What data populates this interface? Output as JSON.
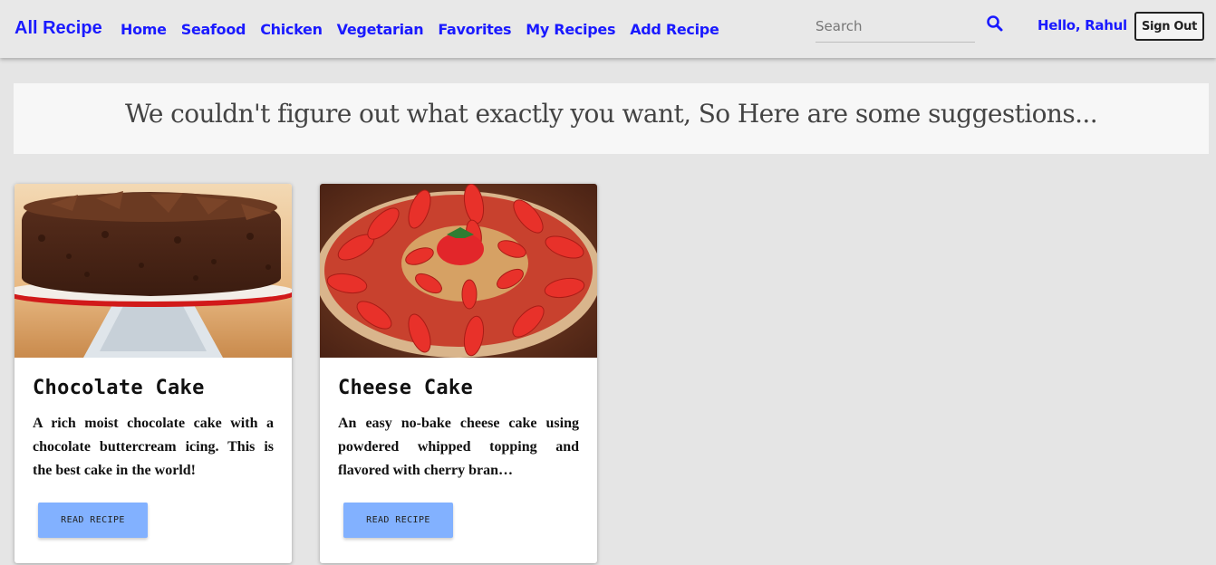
{
  "navbar": {
    "brand": "All Recipe",
    "links": [
      "Home",
      "Seafood",
      "Chicken",
      "Vegetarian",
      "Favorites",
      "My Recipes",
      "Add Recipe"
    ],
    "search_placeholder": "Search",
    "search_icon": "search-icon",
    "greeting": "Hello, Rahul",
    "signout_label": "Sign Out"
  },
  "banner": {
    "message": "We couldn't figure out what exactly you want, So Here are some suggestions..."
  },
  "cards": [
    {
      "title": "Chocolate Cake",
      "description": "A rich moist chocolate cake with a chocolate buttercream icing. This is the best cake in the world!",
      "button_label": "READ RECIPE"
    },
    {
      "title": "Cheese Cake",
      "description": "An easy no-bake cheese cake using powdered whipped topping and flavored with cherry bran…",
      "button_label": "READ RECIPE"
    }
  ],
  "colors": {
    "link": "#1a1aff",
    "button": "#82b1ff",
    "background": "#e5e5e5"
  }
}
